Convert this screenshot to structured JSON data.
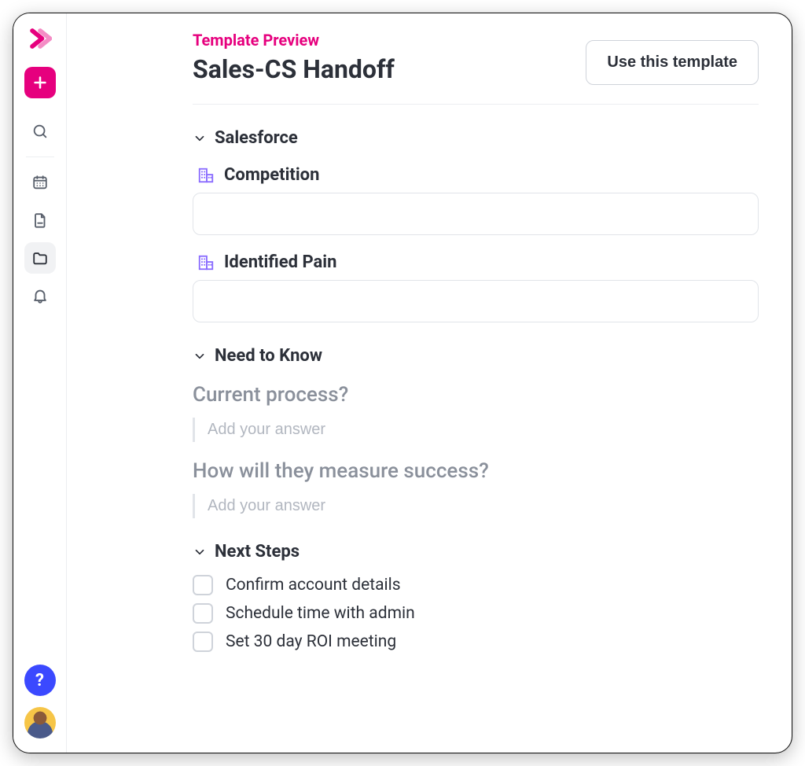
{
  "header": {
    "eyebrow": "Template Preview",
    "title": "Sales-CS Handoff",
    "cta_label": "Use this template"
  },
  "sections": {
    "salesforce": {
      "title": "Salesforce",
      "fields": [
        {
          "label": "Competition",
          "value": ""
        },
        {
          "label": "Identified Pain",
          "value": ""
        }
      ]
    },
    "need_to_know": {
      "title": "Need to Know",
      "questions": [
        {
          "prompt": "Current process?",
          "placeholder": "Add your answer"
        },
        {
          "prompt": "How will they measure success?",
          "placeholder": "Add your answer"
        }
      ]
    },
    "next_steps": {
      "title": "Next Steps",
      "items": [
        {
          "label": "Confirm account details",
          "checked": false
        },
        {
          "label": "Schedule time with admin",
          "checked": false
        },
        {
          "label": "Set 30 day ROI meeting",
          "checked": false
        }
      ]
    }
  },
  "sidebar": {
    "help_label": "?"
  }
}
